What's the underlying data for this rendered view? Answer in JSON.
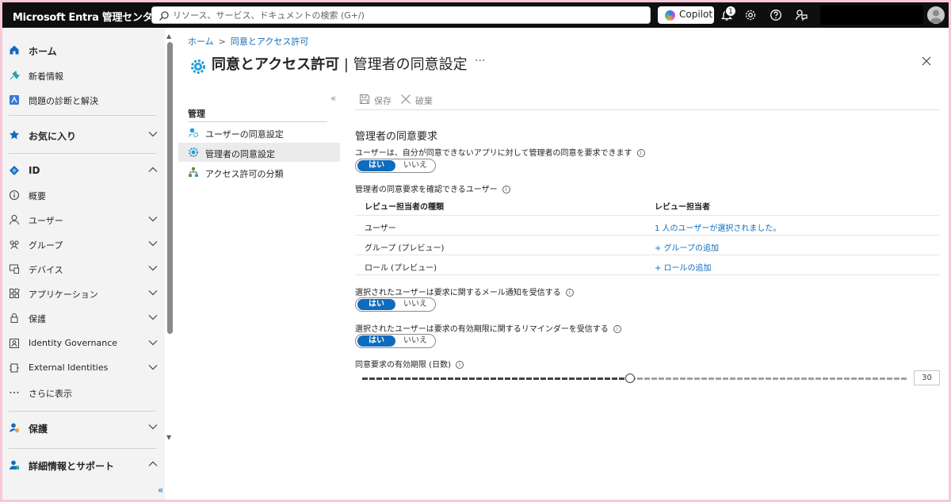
{
  "topbar": {
    "brand": "Microsoft Entra 管理センター",
    "search_placeholder": "リソース、サービス、ドキュメントの検索 (G+/)",
    "copilot_label": "Copilot",
    "notification_count": "1"
  },
  "leftnav": {
    "items": [
      {
        "label": "ホーム",
        "icon": "home-icon"
      },
      {
        "label": "新着情報",
        "icon": "whats-new-icon"
      },
      {
        "label": "問題の診断と解決",
        "icon": "diagnose-icon"
      },
      {
        "label": "お気に入り",
        "icon": "star-icon"
      },
      {
        "label": "ID",
        "icon": "identity-icon"
      },
      {
        "label": "概要",
        "icon": "info-icon"
      },
      {
        "label": "ユーザー",
        "icon": "user-icon"
      },
      {
        "label": "グループ",
        "icon": "group-icon"
      },
      {
        "label": "デバイス",
        "icon": "devices-icon"
      },
      {
        "label": "アプリケーション",
        "icon": "apps-icon"
      },
      {
        "label": "保護",
        "icon": "lock-icon"
      },
      {
        "label": "Identity Governance",
        "icon": "governance-icon"
      },
      {
        "label": "External Identities",
        "icon": "external-icon"
      },
      {
        "label": "さらに表示",
        "icon": "ellipsis-icon"
      },
      {
        "label": "保護",
        "icon": "protection-icon"
      },
      {
        "label": "詳細情報とサポート",
        "icon": "support-icon"
      }
    ],
    "collapse_glyph": "«"
  },
  "breadcrumb": {
    "home": "ホーム",
    "current": "同意とアクセス許可"
  },
  "page": {
    "title_main": "同意とアクセス許可",
    "title_sep": " | ",
    "title_sub": "管理者の同意設定",
    "more": "···"
  },
  "subnav": {
    "heading": "管理",
    "collapse_glyph": "«",
    "items": [
      {
        "label": "ユーザーの同意設定"
      },
      {
        "label": "管理者の同意設定"
      },
      {
        "label": "アクセス許可の分類"
      }
    ]
  },
  "toolbar": {
    "save_label": "保存",
    "discard_label": "破棄"
  },
  "content": {
    "section_title": "管理者の同意要求",
    "q1": "ユーザーは、自分が同意できないアプリに対して管理者の同意を要求できます",
    "reviewers_label": "管理者の同意要求を確認できるユーザー",
    "q_email": "選択されたユーザーは要求に関するメール通知を受信する",
    "q_reminder": "選択されたユーザーは要求の有効期限に関するリマインダーを受信する",
    "expiry_label": "同意要求の有効期限 (日数)",
    "toggle_yes": "はい",
    "toggle_no": "いいえ",
    "info_glyph": "i"
  },
  "reviewer_table": {
    "headers": [
      "レビュー担当者の種類",
      "レビュー担当者"
    ],
    "rows": [
      {
        "type": "ユーザー",
        "value": "1 人のユーザーが選択されました。"
      },
      {
        "type": "グループ (プレビュー)",
        "value": "+ グループの追加"
      },
      {
        "type": "ロール (プレビュー)",
        "value": "+ ロールの追加"
      }
    ]
  },
  "expiry": {
    "value": "30",
    "min": 1,
    "max": 60
  },
  "colors": {
    "accent": "#0f6cbd",
    "topbar": "#0f0f0f"
  }
}
